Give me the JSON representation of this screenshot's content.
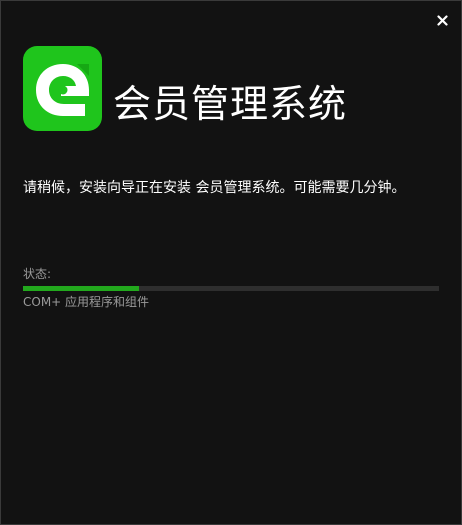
{
  "window": {
    "close_glyph": "✕"
  },
  "header": {
    "logo_icon": "app-logo-icon",
    "title": "会员管理系统"
  },
  "message": "请稍候，安装向导正在安装 会员管理系统。可能需要几分钟。",
  "status": {
    "label": "状态:",
    "progress_fraction": 0.28,
    "detail": "COM+ 应用程序和组件"
  },
  "colors": {
    "background": "#121212",
    "accent": "#22a81d",
    "logo_green": "#1fc51c",
    "text": "#ffffff",
    "muted_text": "#9a9a9a"
  }
}
